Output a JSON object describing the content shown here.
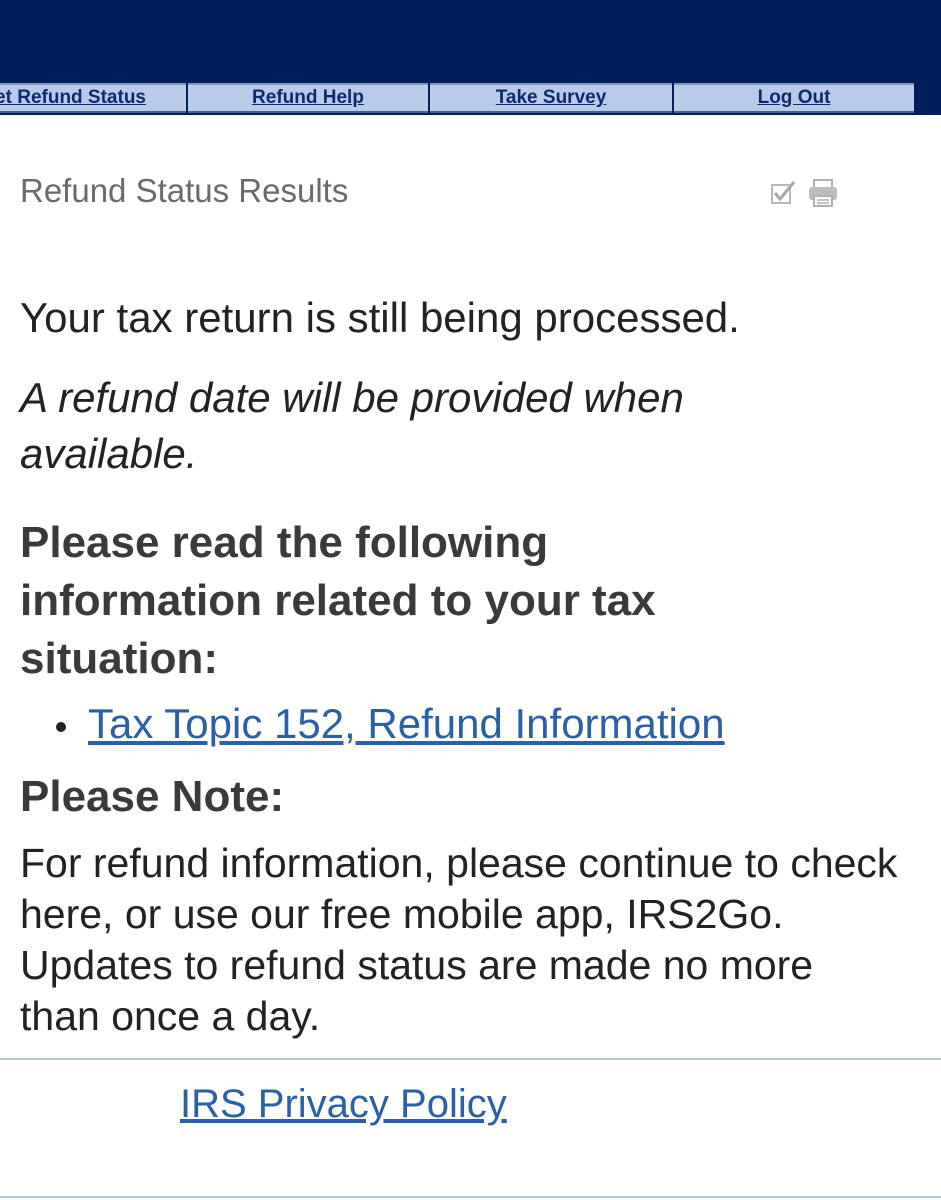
{
  "nav": {
    "tabs": [
      {
        "label": "Get Refund Status"
      },
      {
        "label": "Refund Help"
      },
      {
        "label": "Take Survey"
      },
      {
        "label": "Log Out"
      }
    ]
  },
  "page": {
    "title": "Refund Status Results",
    "icons": [
      "checkmark-icon",
      "print-icon"
    ]
  },
  "status": {
    "main": "Your tax return is still being processed.",
    "sub": "A refund date will be provided when available."
  },
  "info": {
    "heading": "Please read the following information related to your tax situation:",
    "links": [
      {
        "label": "Tax Topic 152, Refund Information"
      }
    ]
  },
  "note": {
    "heading": "Please Note:",
    "body": "For refund information, please continue to check here, or use our free mobile app, IRS2Go. Updates to refund status are made no more than once a day."
  },
  "footer": {
    "privacy_link": "IRS Privacy Policy"
  },
  "colors": {
    "header_band": "#001f5b",
    "tab_background": "#b9cbe6",
    "link": "#2b5fa8"
  }
}
